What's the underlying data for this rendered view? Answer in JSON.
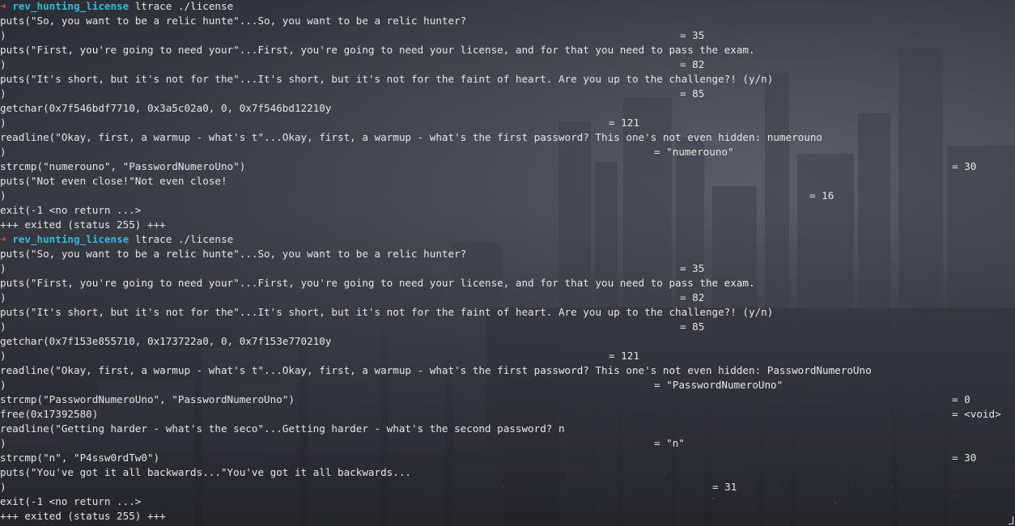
{
  "terminal": {
    "runs": [
      {
        "prompt": {
          "arrow": "➜",
          "dir": "rev_hunting_license",
          "cmd": "ltrace ./license"
        },
        "lines": [
          {
            "text": "puts(\"So, you want to be a relic hunte\"...So, you want to be a relic hunter?"
          },
          {
            "text": ")",
            "value": "= 35"
          },
          {
            "text": "puts(\"First, you're going to need your\"...First, you're going to need your license, and for that you need to pass the exam."
          },
          {
            "text": ")",
            "value": "= 82"
          },
          {
            "text": "puts(\"It's short, but it's not for the\"...It's short, but it's not for the faint of heart. Are you up to the challenge?! (y/n)"
          },
          {
            "text": ")",
            "value": "= 85"
          },
          {
            "text": "getchar(0x7f546bdf7710, 0x3a5c02a0, 0, 0x7f546bd12210y"
          },
          {
            "text": ")",
            "value": "= 121"
          },
          {
            "text": "readline(\"Okay, first, a warmup - what's t\"...Okay, first, a warmup - what's the first password? This one's not even hidden: numerouno"
          },
          {
            "text": ")",
            "value": "= \"numerouno\""
          },
          {
            "text": "strcmp(\"numerouno\", \"PasswordNumeroUno\")",
            "value": "= 30"
          },
          {
            "text": "puts(\"Not even close!\"Not even close!"
          },
          {
            "text": ")",
            "value": "= 16"
          },
          {
            "text": "exit(-1 <no return ...>"
          },
          {
            "text": "+++ exited (status 255) +++"
          }
        ]
      },
      {
        "prompt": {
          "arrow": "➜",
          "dir": "rev_hunting_license",
          "cmd": "ltrace ./license"
        },
        "lines": [
          {
            "text": "puts(\"So, you want to be a relic hunte\"...So, you want to be a relic hunter?"
          },
          {
            "text": ")",
            "value": "= 35"
          },
          {
            "text": "puts(\"First, you're going to need your\"...First, you're going to need your license, and for that you need to pass the exam."
          },
          {
            "text": ")",
            "value": "= 82"
          },
          {
            "text": "puts(\"It's short, but it's not for the\"...It's short, but it's not for the faint of heart. Are you up to the challenge?! (y/n)"
          },
          {
            "text": ")",
            "value": "= 85"
          },
          {
            "text": "getchar(0x7f153e855710, 0x173722a0, 0, 0x7f153e770210y"
          },
          {
            "text": ")",
            "value": "= 121"
          },
          {
            "text": "readline(\"Okay, first, a warmup - what's t\"...Okay, first, a warmup - what's the first password? This one's not even hidden: PasswordNumeroUno"
          },
          {
            "text": ")",
            "value": "= \"PasswordNumeroUno\""
          },
          {
            "text": "strcmp(\"PasswordNumeroUno\", \"PasswordNumeroUno\")",
            "value": "= 0"
          },
          {
            "text": "free(0x17392580)",
            "value": "= <void>"
          },
          {
            "text": "readline(\"Getting harder - what's the seco\"...Getting harder - what's the second password? n"
          },
          {
            "text": ")",
            "value": "= \"n\""
          },
          {
            "text": "strcmp(\"n\", \"P4ssw0rdTw0\")",
            "value": "= 30"
          },
          {
            "text": "puts(\"You've got it all backwards...\"You've got it all backwards..."
          },
          {
            "text": ")",
            "value": "= 31"
          },
          {
            "text": "exit(-1 <no return ...>"
          },
          {
            "text": "+++ exited (status 255) +++"
          }
        ]
      }
    ]
  },
  "colors": {
    "prompt_arrow": "#ef4b4b",
    "prompt_dir": "#39b8d9",
    "text": "#e6e6e6"
  }
}
